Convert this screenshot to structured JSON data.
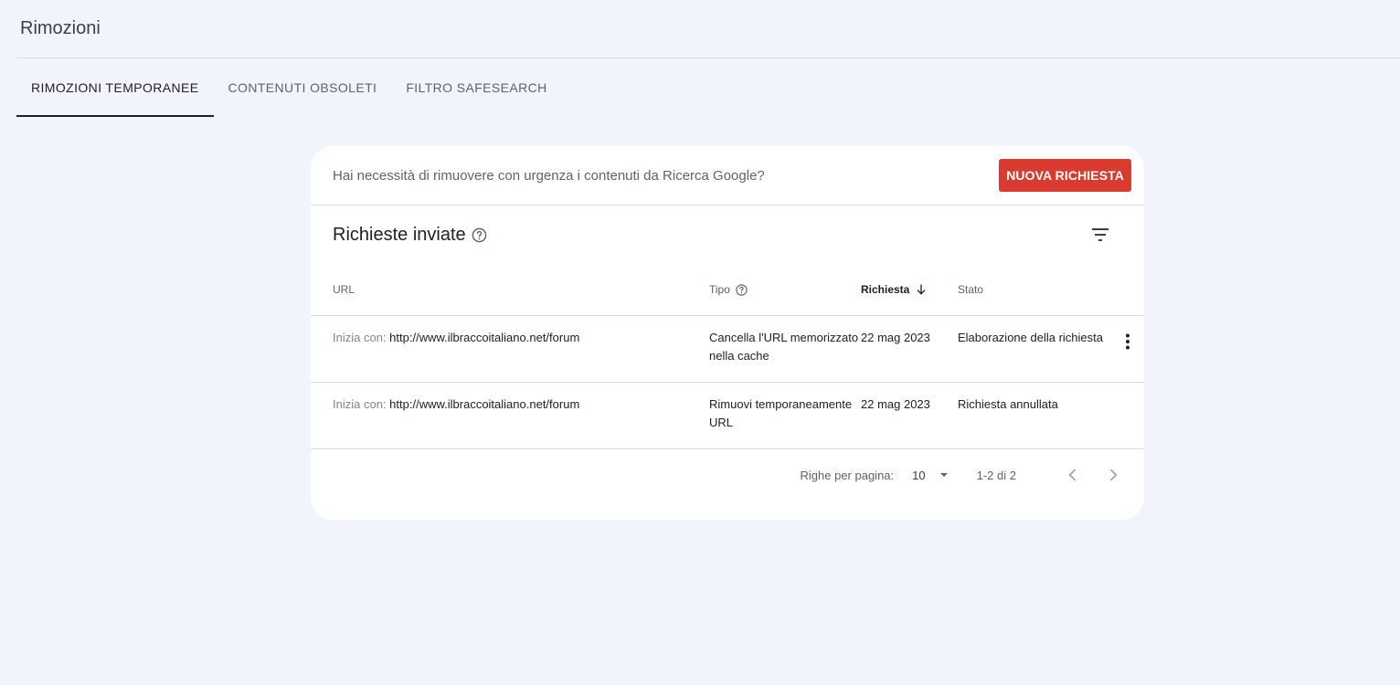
{
  "page": {
    "title": "Rimozioni"
  },
  "tabs": [
    {
      "label": "RIMOZIONI TEMPORANEE",
      "active": true
    },
    {
      "label": "CONTENUTI OBSOLETI",
      "active": false
    },
    {
      "label": "FILTRO SAFESEARCH",
      "active": false
    }
  ],
  "banner": {
    "text": "Hai necessità di rimuovere con urgenza i contenuti da Ricerca Google?",
    "button_label": "NUOVA RICHIESTA"
  },
  "section": {
    "title": "Richieste inviate"
  },
  "table": {
    "headers": {
      "url": "URL",
      "type": "Tipo",
      "date": "Richiesta",
      "state": "Stato"
    },
    "sort": {
      "column": "Richiesta",
      "direction": "descending"
    },
    "rows": [
      {
        "prefix": "Inizia con:",
        "url": "http://www.ilbraccoitaliano.net/forum",
        "type": "Cancella l'URL memorizzato nella cache",
        "date": "22 mag 2023",
        "state": "Elaborazione della richiesta",
        "has_menu": true
      },
      {
        "prefix": "Inizia con:",
        "url": "http://www.ilbraccoitaliano.net/forum",
        "type": "Rimuovi temporaneamente URL",
        "date": "22 mag 2023",
        "state": "Richiesta annullata",
        "has_menu": false
      }
    ]
  },
  "pagination": {
    "rows_label": "Righe per pagina:",
    "rows_value": "10",
    "range_text": "1-2 di 2"
  },
  "colors": {
    "background": "#f1f4fb",
    "accent_button": "#d93b30",
    "card": "#ffffff"
  }
}
